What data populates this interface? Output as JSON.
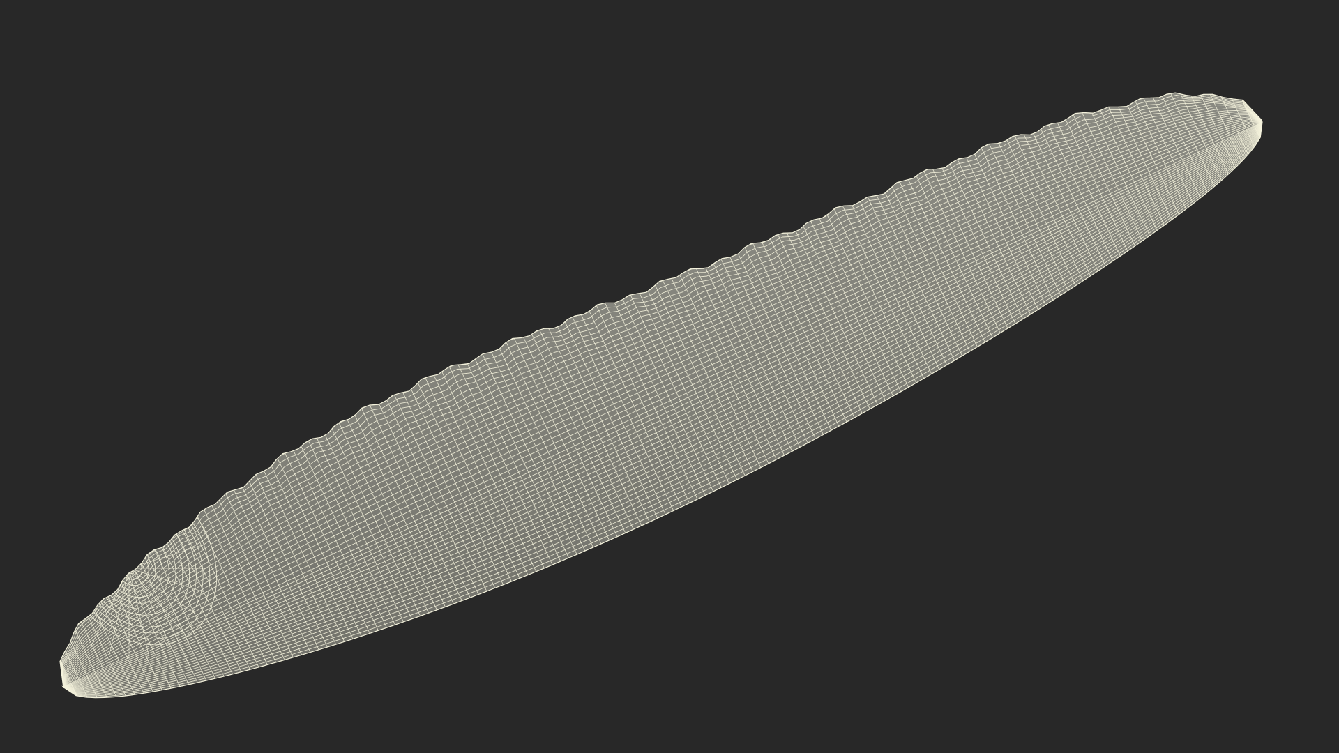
{
  "scene": {
    "subject_icon": "bread-loaf-wireframe-icon",
    "colors": {
      "background": "#282828",
      "mesh_fill": "#82827a",
      "mesh_fill_light": "#92928a",
      "mesh_fill_dark": "#6e6e67",
      "wire": "#f4f2dc"
    }
  }
}
